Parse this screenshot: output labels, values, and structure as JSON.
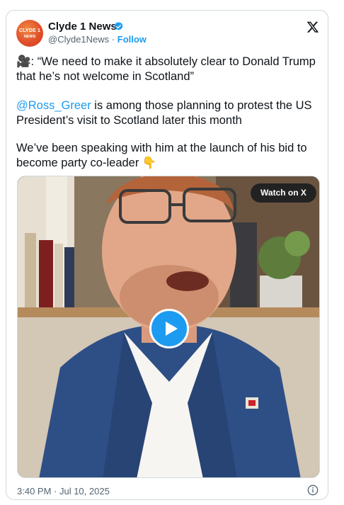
{
  "tweet": {
    "author_name": "Clyde 1 News",
    "handle": "@Clyde1News",
    "separator": "·",
    "follow_label": "Follow",
    "avatar_text_line1": "CLYDE 1",
    "avatar_text_line2": "NEWS",
    "paragraph1": "🎥: “We need to make it absolutely clear to Donald Trump that he’s not welcome in Scotland”",
    "mention": "@Ross_Greer",
    "paragraph2_rest": " is among those planning to protest the US President’s visit to Scotland later this month",
    "paragraph3": "We’ve been speaking with him at the launch of his bid to become party co-leader 👇",
    "timestamp": "3:40 PM · Jul 10, 2025"
  },
  "video": {
    "watch_label": "Watch on X"
  },
  "colors": {
    "accent": "#1d9bf0",
    "text": "#0f1419",
    "muted": "#536471",
    "border": "#cfd9de",
    "avatar": "#e2502a"
  },
  "icons": [
    "verified-badge-icon",
    "x-logo-icon",
    "play-icon",
    "info-icon"
  ]
}
